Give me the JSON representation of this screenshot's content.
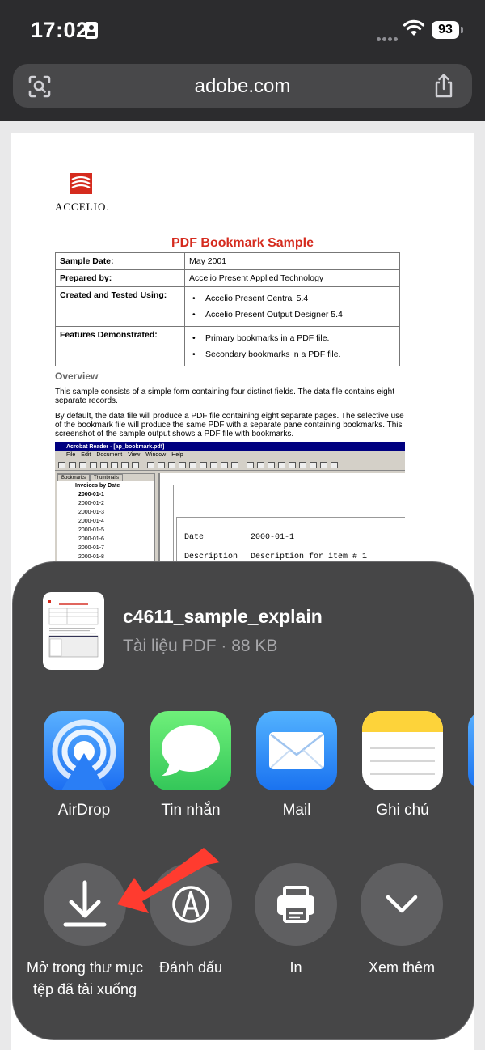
{
  "status_bar": {
    "time": "17:02",
    "battery": "93"
  },
  "browser": {
    "url": "adobe.com"
  },
  "pdf": {
    "logo_text": "ACCELIO.",
    "title": "PDF Bookmark Sample",
    "table": [
      {
        "key": "Sample Date:",
        "values": [
          "May 2001"
        ],
        "bullets": false
      },
      {
        "key": "Prepared by:",
        "values": [
          "Accelio Present Applied Technology"
        ],
        "bullets": false
      },
      {
        "key": "Created and Tested Using:",
        "values": [
          "Accelio Present Central 5.4",
          "Accelio Present Output Designer 5.4"
        ],
        "bullets": true
      },
      {
        "key": "Features Demonstrated:",
        "values": [
          "Primary bookmarks in a PDF file.",
          "Secondary bookmarks in a PDF file."
        ],
        "bullets": true
      }
    ],
    "overview_heading": "Overview",
    "overview_p1": "This sample consists of a simple form containing four distinct fields. The data file contains eight separate records.",
    "overview_p2": "By default, the data file will produce a PDF file containing eight separate pages. The selective use of the bookmark file will produce the same PDF with a separate pane containing bookmarks. This screenshot of the sample output shows a PDF file with bookmarks.",
    "embed": {
      "window_title": "Acrobat Reader - [ap_bookmark.pdf]",
      "menu": [
        "File",
        "Edit",
        "Document",
        "View",
        "Window",
        "Help"
      ],
      "tabs": [
        "Bookmarks",
        "Thumbnails"
      ],
      "tree_root": "Invoices by Date",
      "tree_items": [
        "2000-01-1",
        "2000-01-2",
        "2000-01-3",
        "2000-01-4",
        "2000-01-5",
        "2000-01-6",
        "2000-01-7",
        "2000-01-8"
      ],
      "date_label": "Date",
      "date_value": "2000-01-1",
      "desc_label": "Description",
      "desc_value": "Description for item # 1"
    }
  },
  "share_sheet": {
    "file_name": "c4611_sample_explain",
    "file_meta": "Tài liệu PDF · 88 KB",
    "apps": [
      {
        "label": "AirDrop",
        "icon": "airdrop-icon"
      },
      {
        "label": "Tin nhắn",
        "icon": "messages-icon"
      },
      {
        "label": "Mail",
        "icon": "mail-icon"
      },
      {
        "label": "Ghi chú",
        "icon": "notes-icon"
      }
    ],
    "actions": [
      {
        "label": "Mở trong thư mục tệp đã tải xuống",
        "icon": "download-icon"
      },
      {
        "label": "Đánh dấu",
        "icon": "markup-icon"
      },
      {
        "label": "In",
        "icon": "printer-icon"
      },
      {
        "label": "Xem thêm",
        "icon": "chevron-down-icon"
      }
    ]
  },
  "colors": {
    "pdf_accent": "#d52b1e",
    "annotation_arrow": "#ff3b2f",
    "sheet_bg": "#464647"
  }
}
